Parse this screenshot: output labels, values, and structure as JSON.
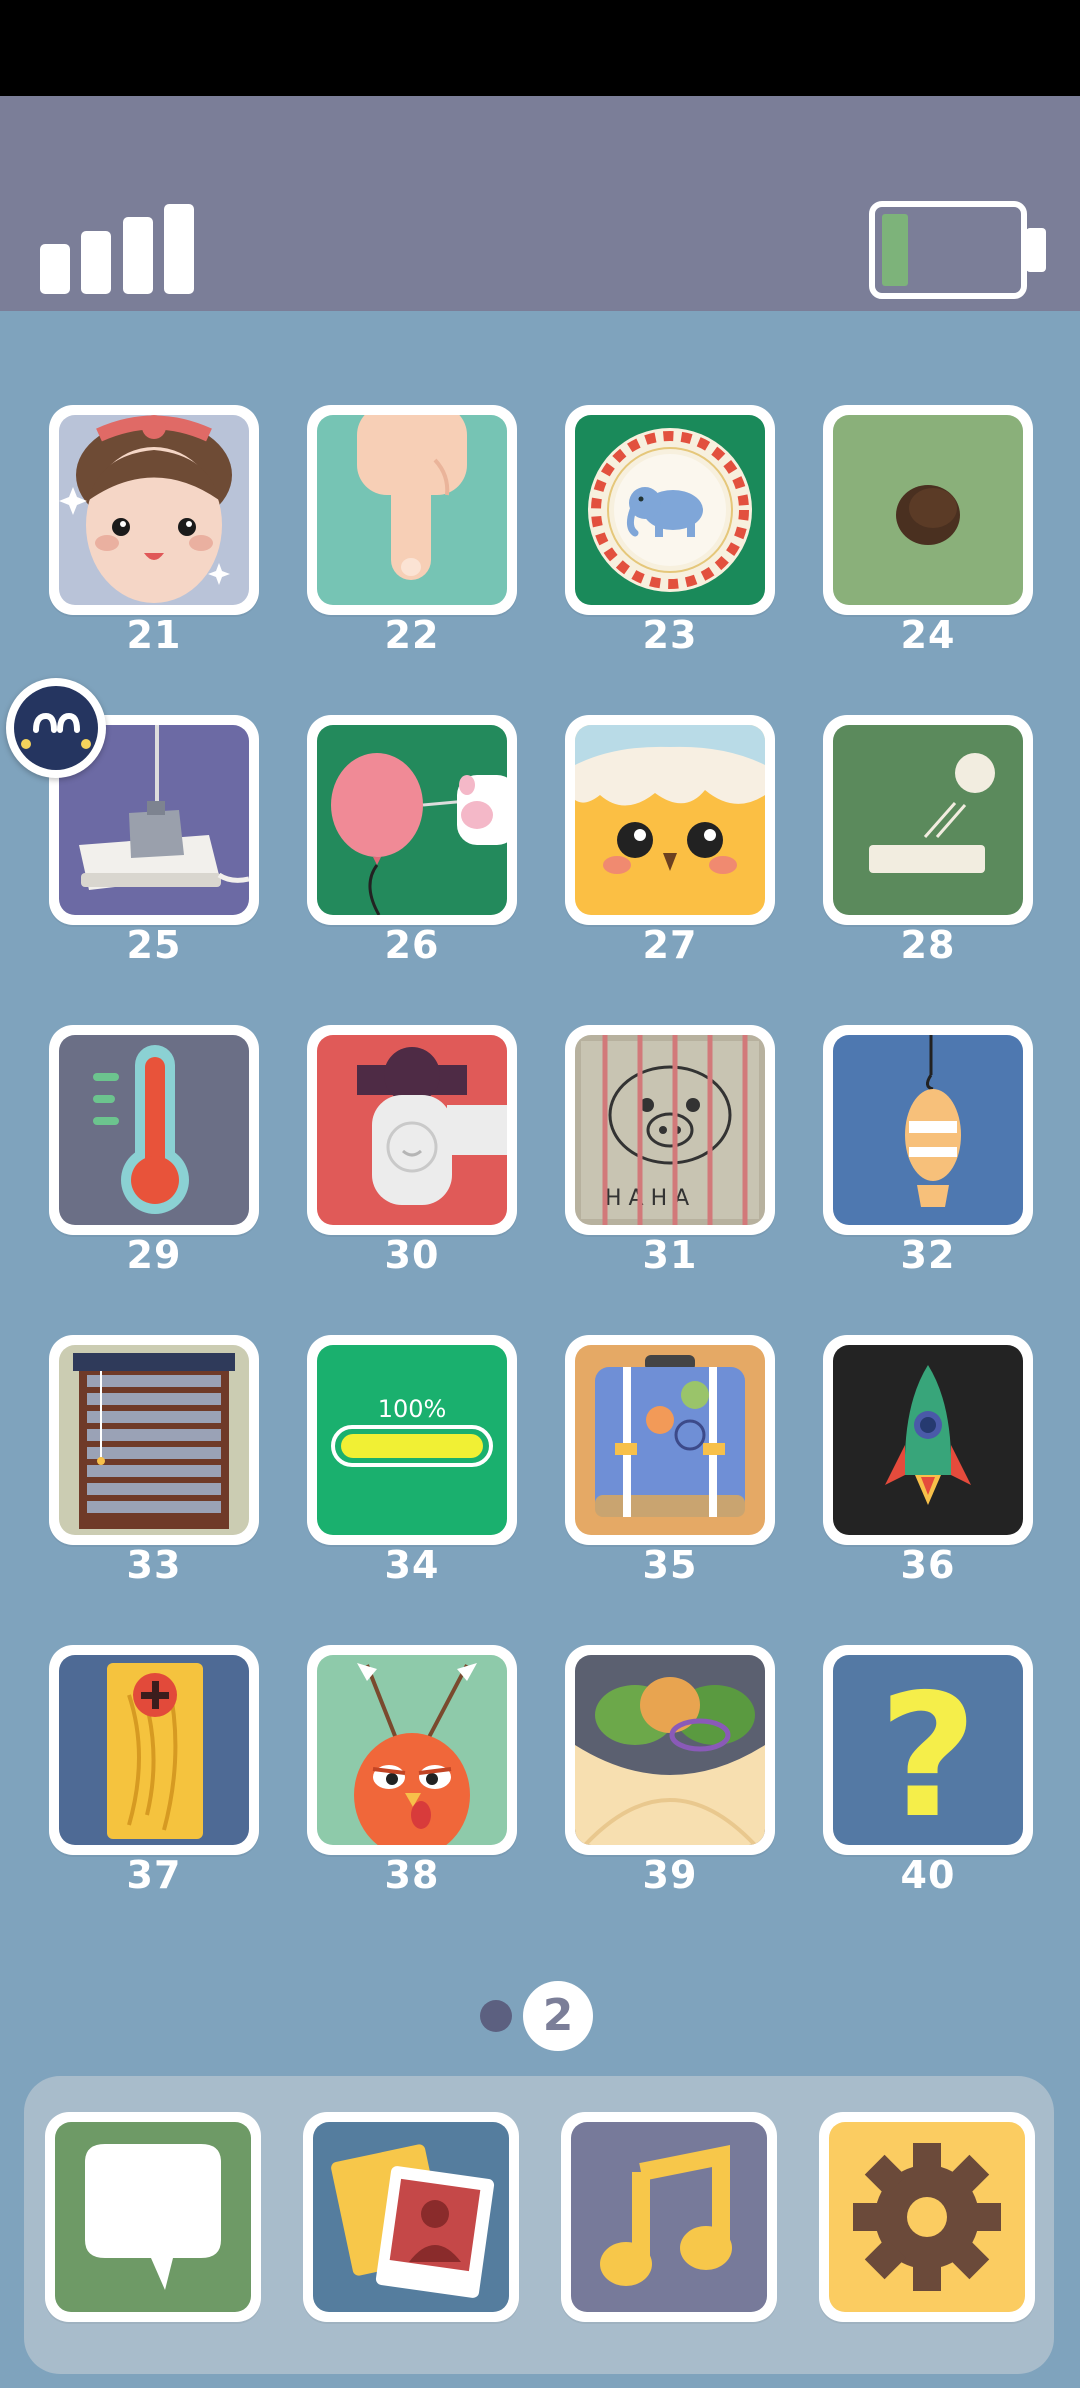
{
  "status": {
    "signal_icon": "signal-bars-icon",
    "battery_icon": "battery-low-icon",
    "battery_level": 0.2
  },
  "levels": [
    {
      "number": "21",
      "icon": "girl-face-icon"
    },
    {
      "number": "22",
      "icon": "pointing-finger-icon"
    },
    {
      "number": "23",
      "icon": "elephant-plate-icon"
    },
    {
      "number": "24",
      "icon": "hole-icon"
    },
    {
      "number": "25",
      "icon": "power-plug-icon"
    },
    {
      "number": "26",
      "icon": "balloon-needle-icon"
    },
    {
      "number": "27",
      "icon": "chick-egg-icon"
    },
    {
      "number": "28",
      "icon": "ball-launcher-icon"
    },
    {
      "number": "29",
      "icon": "thermometer-icon"
    },
    {
      "number": "30",
      "icon": "faucet-icon"
    },
    {
      "number": "31",
      "icon": "pig-drawing-icon"
    },
    {
      "number": "32",
      "icon": "fish-hook-icon"
    },
    {
      "number": "33",
      "icon": "window-blinds-icon"
    },
    {
      "number": "34",
      "icon": "battery-full-icon",
      "label": "100%"
    },
    {
      "number": "35",
      "icon": "suitcase-icon"
    },
    {
      "number": "36",
      "icon": "rocket-icon"
    },
    {
      "number": "37",
      "icon": "wooden-board-icon"
    },
    {
      "number": "38",
      "icon": "turkey-arrows-icon"
    },
    {
      "number": "39",
      "icon": "burrito-icon"
    },
    {
      "number": "40",
      "icon": "question-mark-icon"
    }
  ],
  "hint": {
    "icon": "hint-face-icon"
  },
  "pager": {
    "current": "2",
    "total_pages": 2
  },
  "dock": [
    {
      "icon": "chat-bubble-icon"
    },
    {
      "icon": "photos-icon"
    },
    {
      "icon": "music-note-icon"
    },
    {
      "icon": "settings-gear-icon"
    }
  ],
  "colors": {
    "background": "#7fa3bd",
    "status_bar": "#7b7e98",
    "number_text": "#ffffff",
    "tile_border": "#ffffff"
  }
}
